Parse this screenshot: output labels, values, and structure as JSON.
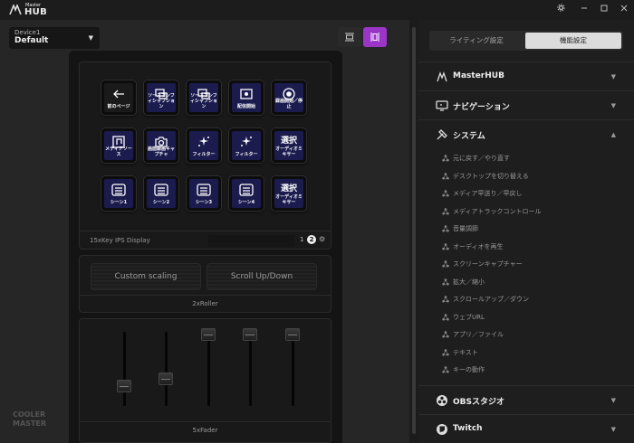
{
  "titlebar": {
    "logo_small": "Master",
    "logo_big": "HUB",
    "icons": [
      "gear-icon",
      "minimize-icon",
      "maximize-icon",
      "close-icon"
    ]
  },
  "device_select": {
    "label": "Device1",
    "value": "Default"
  },
  "view_buttons": [
    {
      "icon": "single-panel-icon",
      "active": false
    },
    {
      "icon": "split-panel-icon",
      "active": true,
      "color": "#9b35c8"
    }
  ],
  "keypad": {
    "title": "15xKey IPS Display",
    "page_numbers": [
      "1",
      "2"
    ],
    "keys": [
      {
        "label": "前のページ",
        "icon": "back-arrow-icon",
        "dark": true
      },
      {
        "label": "ソースコンフィシャフション",
        "icon": "scene-swap-icon"
      },
      {
        "label": "ソースコンフィシャフション",
        "icon": "scene-swap-icon"
      },
      {
        "label": "配信開始",
        "icon": "live-icon"
      },
      {
        "label": "録画開始／停止",
        "icon": "record-icon"
      },
      {
        "label": "メディアソース",
        "icon": "media-source-icon"
      },
      {
        "label": "画面録画キャプチャ",
        "icon": "camera-icon"
      },
      {
        "label": "フィルター",
        "icon": "sparkle-icon"
      },
      {
        "label": "フィルター",
        "icon": "sparkle-icon"
      },
      {
        "label": "オーディオミキサー",
        "big": "選択"
      },
      {
        "label": "シーン1",
        "icon": "scene-list-icon"
      },
      {
        "label": "シーン2",
        "icon": "scene-list-icon"
      },
      {
        "label": "シーン3",
        "icon": "scene-list-icon"
      },
      {
        "label": "シーン4",
        "icon": "scene-list-icon"
      },
      {
        "label": "オーディオミキサー",
        "big": "選択"
      }
    ]
  },
  "roller": {
    "title": "2xRoller",
    "left_label": "Custom scaling",
    "right_label": "Scroll Up/Down"
  },
  "fader": {
    "title": "5xFader",
    "levels": [
      0.3,
      0.4,
      1.0,
      1.0,
      1.0
    ]
  },
  "brand_logo": [
    "COOLER",
    "MASTER"
  ],
  "right": {
    "tabs": [
      "ライティング設定",
      "機能設定"
    ],
    "sections": [
      {
        "label": "MasterHUB",
        "icon": "masterhub-icon",
        "expanded": false
      },
      {
        "label": "ナビゲーション",
        "icon": "navigation-icon",
        "expanded": false
      },
      {
        "label": "システム",
        "icon": "system-icon",
        "expanded": true,
        "items": [
          "元に戻す／やり直す",
          "デスクトップを切り替える",
          "メディア早送り／早戻し",
          "メディアトラックコントロール",
          "音量調節",
          "オーディオを再生",
          "スクリーンキャプチャー",
          "拡大／縮小",
          "スクロールアップ／ダウン",
          "ウェブURL",
          "アプリ／ファイル",
          "テキスト",
          "キーの動作"
        ]
      },
      {
        "label": "OBSスタジオ",
        "icon": "obs-icon",
        "expanded": false
      },
      {
        "label": "Twitch",
        "icon": "twitch-icon",
        "expanded": false
      }
    ]
  }
}
